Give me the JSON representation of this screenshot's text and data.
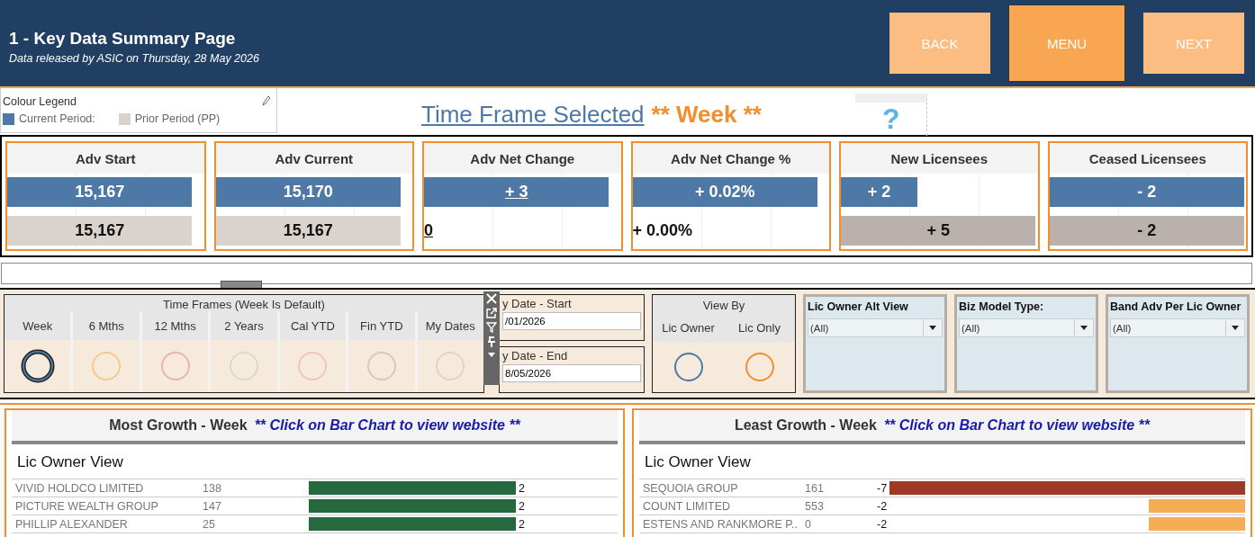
{
  "header": {
    "title": "1 - Key Data Summary Page",
    "subtitle": "Data released by ASIC on Thursday, 28 May 2026",
    "buttons": [
      {
        "label": "BACK",
        "selected": false
      },
      {
        "label": "MENU",
        "selected": true
      },
      {
        "label": "NEXT",
        "selected": false
      }
    ]
  },
  "legend": {
    "title": "Colour Legend",
    "items": [
      {
        "label": "Current Period:",
        "color": "#4e79a7"
      },
      {
        "label": "Prior Period (PP)",
        "color": "#d9d2cd"
      }
    ]
  },
  "time_frame": {
    "label": "Time Frame Selected",
    "value": "** Week **",
    "help": "?"
  },
  "kpis": [
    {
      "title": "Adv Start",
      "current": {
        "text": "15,167",
        "level": 0.94,
        "underlined": false
      },
      "prior": {
        "text": "15,167",
        "level": 0.94,
        "underlined": false,
        "color": "#d9d2cd"
      }
    },
    {
      "title": "Adv Current",
      "current": {
        "text": "15,170",
        "level": 0.94,
        "underlined": false
      },
      "prior": {
        "text": "15,167",
        "level": 0.94,
        "underlined": false,
        "color": "#d9d2cd"
      }
    },
    {
      "title": "Adv Net Change",
      "current": {
        "text": "+ 3",
        "level": 0.94,
        "underlined": true
      },
      "prior": {
        "text": "0",
        "underlined": true
      }
    },
    {
      "title": "Adv Net Change %",
      "current": {
        "text": "+ 0.02%",
        "level": 0.94,
        "underlined": false
      },
      "prior": {
        "text": "+ 0.00%",
        "underlined": false
      }
    },
    {
      "title": "New Licensees",
      "current": {
        "text": "+ 2",
        "level": 0.39,
        "underlined": false
      },
      "prior": {
        "text": "+ 5",
        "level": 0.99,
        "underlined": false,
        "color": "#bab0ac"
      }
    },
    {
      "title": "Ceased Licensees",
      "current": {
        "text": "- 2",
        "level": 0.99,
        "underlined": false
      },
      "prior": {
        "text": "- 2",
        "level": 0.99,
        "underlined": false,
        "color": "#bab0ac"
      }
    }
  ],
  "time_frames": {
    "title": "Time Frames (Week Is Default)",
    "options": [
      {
        "label": "Week",
        "selected": true,
        "color": "#4e79a7"
      },
      {
        "label": "6 Mths",
        "selected": false,
        "color": "#f6c990"
      },
      {
        "label": "12 Mths",
        "selected": false,
        "color": "#eab4a8"
      },
      {
        "label": "2 Years",
        "selected": false,
        "color": "#d6dcc8"
      },
      {
        "label": "Cal YTD",
        "selected": false,
        "color": "#f2c6b8"
      },
      {
        "label": "Fin YTD",
        "selected": false,
        "color": "#dcc8b6"
      },
      {
        "label": "My Dates",
        "selected": false,
        "color": "#e4d2c6"
      }
    ]
  },
  "dates": [
    {
      "label": "y Date - Start",
      "value": "/01/2026"
    },
    {
      "label": "y Date - End",
      "value": "8/05/2026"
    }
  ],
  "view_by": {
    "title": "View By",
    "options": [
      {
        "label": "Lic Owner",
        "color": "#4e79a7"
      },
      {
        "label": "Lic Only",
        "color": "#f28e2b"
      }
    ]
  },
  "filters": [
    {
      "label": "Lic Owner Alt View",
      "value": "(All)"
    },
    {
      "label": "Biz Model Type:",
      "value": "(All)"
    },
    {
      "label": "Band Adv Per Lic Owner",
      "value": "(All)"
    }
  ],
  "panels": [
    {
      "title": "Most Growth - Week",
      "note": "** Click on Bar Chart to view website **",
      "subtitle": "Lic Owner View",
      "kind": "growth",
      "rows": [
        {
          "name": "VIVID HOLDCO LIMITED",
          "count": "138",
          "value": "2",
          "level": 1,
          "color": "#256a3e"
        },
        {
          "name": "PICTURE WEALTH GROUP",
          "count": "147",
          "value": "2",
          "level": 1,
          "color": "#256a3e"
        },
        {
          "name": "PHILLIP  ALEXANDER",
          "count": "25",
          "value": "2",
          "level": 1,
          "color": "#256a3e"
        }
      ]
    },
    {
      "title": "Least Growth - Week",
      "note": "** Click on Bar Chart to view website **",
      "subtitle": "Lic Owner View",
      "kind": "decline",
      "rows": [
        {
          "name": "SEQUOIA GROUP",
          "count": "161",
          "value": "-7",
          "level": 1,
          "color": "#9e3a23"
        },
        {
          "name": "COUNT LIMITED",
          "count": "553",
          "value": "-2",
          "level": 0.27,
          "color": "#f5ad55"
        },
        {
          "name": "ESTENS AND RANKMORE P..",
          "count": "0",
          "value": "-2",
          "level": 0.27,
          "color": "#f5ad55"
        }
      ]
    }
  ]
}
